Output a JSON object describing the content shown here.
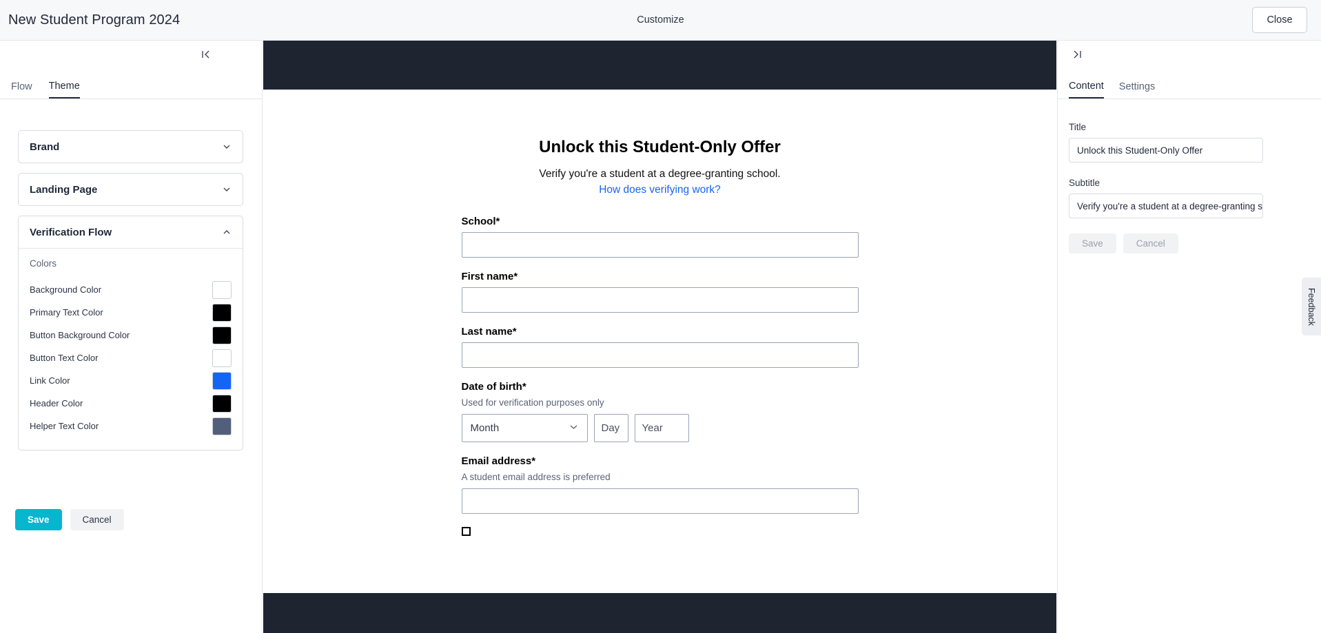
{
  "topbar": {
    "title": "New Student Program 2024",
    "center_label": "Customize",
    "close_label": "Close"
  },
  "left_panel": {
    "collapse_icon": "collapse-left-icon",
    "tabs": [
      {
        "label": "Flow",
        "active": false
      },
      {
        "label": "Theme",
        "active": true
      }
    ],
    "sections": [
      {
        "label": "Brand",
        "expanded": false
      },
      {
        "label": "Landing Page",
        "expanded": false
      },
      {
        "label": "Verification Flow",
        "expanded": true
      }
    ],
    "colors_heading": "Colors",
    "colors": [
      {
        "label": "Background Color",
        "value": "#ffffff"
      },
      {
        "label": "Primary Text Color",
        "value": "#000000"
      },
      {
        "label": "Button Background Color",
        "value": "#000000"
      },
      {
        "label": "Button Text Color",
        "value": "#ffffff"
      },
      {
        "label": "Link Color",
        "value": "#1565f5"
      },
      {
        "label": "Header Color",
        "value": "#000000"
      },
      {
        "label": "Helper Text Color",
        "value": "#525f7a"
      }
    ],
    "save_label": "Save",
    "cancel_label": "Cancel"
  },
  "preview": {
    "header_color": "#1e2430",
    "footer_color": "#1e2430",
    "title": "Unlock this Student-Only Offer",
    "subtitle": "Verify you're a student at a degree-granting school.",
    "link": "How does verifying work?",
    "fields": [
      {
        "label": "School*",
        "help": "",
        "value": ""
      },
      {
        "label": "First name*",
        "help": "",
        "value": ""
      },
      {
        "label": "Last name*",
        "help": "",
        "value": ""
      }
    ],
    "dob": {
      "label": "Date of birth*",
      "help": "Used for verification purposes only",
      "month_placeholder": "Month",
      "day_placeholder": "Day",
      "year_placeholder": "Year"
    },
    "email": {
      "label": "Email address*",
      "help": "A student email address is preferred",
      "value": ""
    }
  },
  "right_panel": {
    "collapse_icon": "collapse-right-icon",
    "tabs": [
      {
        "label": "Content",
        "active": true
      },
      {
        "label": "Settings",
        "active": false
      }
    ],
    "title_label": "Title",
    "title_value": "Unlock this Student-Only Offer",
    "subtitle_label": "Subtitle",
    "subtitle_value": "Verify you're a student at a degree-granting sch",
    "save_label": "Save",
    "cancel_label": "Cancel",
    "feedback_label": "Feedback"
  }
}
